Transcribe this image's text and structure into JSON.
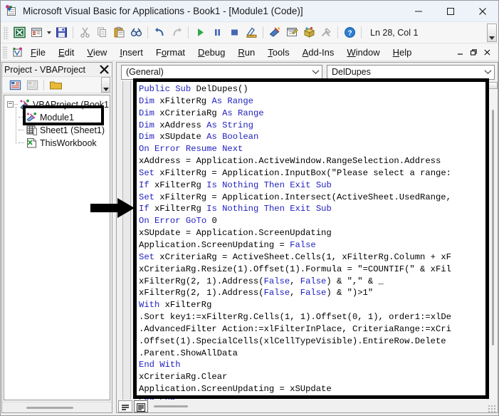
{
  "window": {
    "title": "Microsoft Visual Basic for Applications - Book1 - [Module1 (Code)]",
    "app_icon": "vba-icon",
    "minimize_label": "–",
    "maximize_label": "☐",
    "close_label": "✕"
  },
  "toolbar": {
    "status_text": "Ln 28, Col 1",
    "buttons": [
      {
        "name": "view-excel-button",
        "icon": "excel-grid-icon",
        "tooltip": "View Microsoft Excel"
      },
      {
        "name": "insert-userform-button",
        "icon": "userform-icon",
        "tooltip": "Insert UserForm"
      },
      {
        "name": "insert-dropdown-button",
        "icon": "chevron-down-icon",
        "tooltip": "Insert"
      },
      {
        "name": "save-button",
        "icon": "floppy-disk-icon",
        "tooltip": "Save Book1"
      },
      {
        "name": "cut-button",
        "icon": "scissors-icon",
        "tooltip": "Cut"
      },
      {
        "name": "copy-button",
        "icon": "copy-pages-icon",
        "tooltip": "Copy"
      },
      {
        "name": "paste-button",
        "icon": "clipboard-icon",
        "tooltip": "Paste"
      },
      {
        "name": "find-button",
        "icon": "binoculars-icon",
        "tooltip": "Find"
      },
      {
        "name": "undo-button",
        "icon": "undo-arrow-icon",
        "tooltip": "Undo"
      },
      {
        "name": "redo-button",
        "icon": "redo-arrow-icon",
        "tooltip": "Redo"
      },
      {
        "name": "run-button",
        "icon": "play-triangle-icon",
        "tooltip": "Run Sub/UserForm"
      },
      {
        "name": "break-button",
        "icon": "pause-bars-icon",
        "tooltip": "Break"
      },
      {
        "name": "reset-button",
        "icon": "stop-square-icon",
        "tooltip": "Reset"
      },
      {
        "name": "design-mode-button",
        "icon": "ruler-pencil-icon",
        "tooltip": "Design Mode"
      },
      {
        "name": "project-explorer-button",
        "icon": "project-explorer-icon",
        "tooltip": "Project Explorer"
      },
      {
        "name": "properties-window-button",
        "icon": "properties-window-icon",
        "tooltip": "Properties Window"
      },
      {
        "name": "object-browser-button",
        "icon": "object-browser-icon",
        "tooltip": "Object Browser"
      },
      {
        "name": "toolbox-button",
        "icon": "hammer-wrench-icon",
        "tooltip": "Toolbox"
      },
      {
        "name": "help-button",
        "icon": "help-question-icon",
        "tooltip": "Help"
      }
    ],
    "overflow_label": "▼"
  },
  "menubar": {
    "icon": "vba-control-icon",
    "items": [
      {
        "label": "File",
        "mnemonic": "F"
      },
      {
        "label": "Edit",
        "mnemonic": "E"
      },
      {
        "label": "View",
        "mnemonic": "V"
      },
      {
        "label": "Insert",
        "mnemonic": "I"
      },
      {
        "label": "Format",
        "mnemonic": "o"
      },
      {
        "label": "Debug",
        "mnemonic": "D"
      },
      {
        "label": "Run",
        "mnemonic": "R"
      },
      {
        "label": "Tools",
        "mnemonic": "T"
      },
      {
        "label": "Add-Ins",
        "mnemonic": "A"
      },
      {
        "label": "Window",
        "mnemonic": "W"
      },
      {
        "label": "Help",
        "mnemonic": "H"
      }
    ],
    "mdi_minimize": "–",
    "mdi_restore": "❐",
    "mdi_close": "✕"
  },
  "project_explorer": {
    "title": "Project - VBAProject",
    "close_label": "✕",
    "toolbar": [
      {
        "name": "view-code-button",
        "icon": "view-code-icon"
      },
      {
        "name": "view-object-button",
        "icon": "view-object-icon"
      },
      {
        "name": "toggle-folders-button",
        "icon": "folder-icon"
      }
    ],
    "overflow_label": "▼",
    "tree": [
      {
        "label": "VBAProject (Book1",
        "icon": "project-node-icon",
        "level": 0,
        "expander": "−"
      },
      {
        "label": "Module1",
        "icon": "module-icon",
        "level": 1,
        "selected": true
      },
      {
        "label": "Sheet1 (Sheet1)",
        "icon": "worksheet-icon",
        "level": 1
      },
      {
        "label": "ThisWorkbook",
        "icon": "workbook-icon",
        "level": 1
      }
    ]
  },
  "code_window": {
    "object_combo": {
      "value": "(General)",
      "chevron": "⌄"
    },
    "procedure_combo": {
      "value": "DelDupes",
      "chevron": "⌄"
    },
    "view_buttons": [
      {
        "name": "procedure-view-button",
        "icon": "procedure-view-icon",
        "active": false
      },
      {
        "name": "full-module-view-button",
        "icon": "full-module-view-icon",
        "active": true
      }
    ],
    "code": "Public Sub DelDupes()\nDim xFilterRg As Range\nDim xCriteriaRg As Range\nDim xAddress As String\nDim xSUpdate As Boolean\nOn Error Resume Next\nxAddress = Application.ActiveWindow.RangeSelection.Address\nSet xFilterRg = Application.InputBox(\"Please select a range:\nIf xFilterRg Is Nothing Then Exit Sub\nSet xFilterRg = Application.Intersect(ActiveSheet.UsedRange,\nIf xFilterRg Is Nothing Then Exit Sub\nOn Error GoTo 0\nxSUpdate = Application.ScreenUpdating\nApplication.ScreenUpdating = False\nSet xCriteriaRg = ActiveSheet.Cells(1, xFilterRg.Column + xF\nxCriteriaRg.Resize(1).Offset(1).Formula = \"=COUNTIF(\" & xFil\nxFilterRg(2, 1).Address(False, False) & \",\" & _\nxFilterRg(2, 1).Address(False, False) & \")>1\"\nWith xFilterRg\n.Sort key1:=xFilterRg.Cells(1, 1).Offset(0, 1), order1:=xlDe\n.AdvancedFilter Action:=xlFilterInPlace, CriteriaRange:=xCri\n.Offset(1).SpecialCells(xlCellTypeVisible).EntireRow.Delete\n.Parent.ShowAllData\nEnd With\nxCriteriaRg.Clear\nApplication.ScreenUpdating = xSUpdate\nEnd Sub",
    "code_lines": [
      "Public Sub DelDupes()",
      "Dim xFilterRg As Range",
      "Dim xCriteriaRg As Range",
      "Dim xAddress As String",
      "Dim xSUpdate As Boolean",
      "On Error Resume Next",
      "xAddress = Application.ActiveWindow.RangeSelection.Address",
      "Set xFilterRg = Application.InputBox(\"Please select a range:",
      "If xFilterRg Is Nothing Then Exit Sub",
      "Set xFilterRg = Application.Intersect(ActiveSheet.UsedRange,",
      "If xFilterRg Is Nothing Then Exit Sub",
      "On Error GoTo 0",
      "xSUpdate = Application.ScreenUpdating",
      "Application.ScreenUpdating = False",
      "Set xCriteriaRg = ActiveSheet.Cells(1, xFilterRg.Column + xF",
      "xCriteriaRg.Resize(1).Offset(1).Formula = \"=COUNTIF(\" & xFil",
      "xFilterRg(2, 1).Address(False, False) & \",\" & _",
      "xFilterRg(2, 1).Address(False, False) & \")>1\"",
      "With xFilterRg",
      ".Sort key1:=xFilterRg.Cells(1, 1).Offset(0, 1), order1:=xlDe",
      ".AdvancedFilter Action:=xlFilterInPlace, CriteriaRange:=xCri",
      ".Offset(1).SpecialCells(xlCellTypeVisible).EntireRow.Delete",
      ".Parent.ShowAllData",
      "End With",
      "xCriteriaRg.Clear",
      "Application.ScreenUpdating = xSUpdate",
      "End Sub"
    ]
  },
  "annotations": {
    "code_box": {
      "shape": "rectangle",
      "color": "#000000"
    },
    "module_box": {
      "shape": "rectangle",
      "color": "#000000"
    },
    "pointer_arrow": {
      "shape": "arrow-right",
      "color": "#000000"
    }
  },
  "colors": {
    "keyword": "#1f1fbf",
    "code_text": "#000000",
    "titlebar": "#eef3fa",
    "chrome": "#f6f6f6",
    "annotation": "#000000"
  }
}
